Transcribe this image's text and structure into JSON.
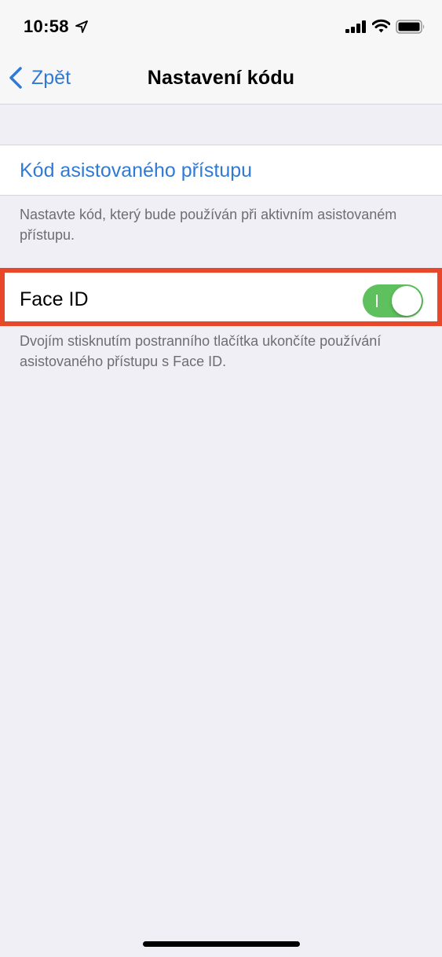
{
  "status_bar": {
    "time": "10:58",
    "icons": [
      "location-arrow-icon",
      "cellular-signal-icon",
      "wifi-icon",
      "battery-icon"
    ]
  },
  "nav": {
    "back_label": "Zpět",
    "title": "Nastavení kódu"
  },
  "sections": {
    "passcode": {
      "label": "Kód asistovaného přístupu",
      "footer": "Nastavte kód, který bude používán při aktivním asistovaném přístupu."
    },
    "face_id": {
      "label": "Face ID",
      "toggle_on": true,
      "footer": "Dvojím stisknutím postranního tlačítka ukončíte používání asistovaného přístupu s Face ID."
    }
  },
  "colors": {
    "accent": "#2f7ad6",
    "toggle_on": "#5fc05e",
    "highlight": "#e8472a",
    "background": "#f0eff5"
  }
}
